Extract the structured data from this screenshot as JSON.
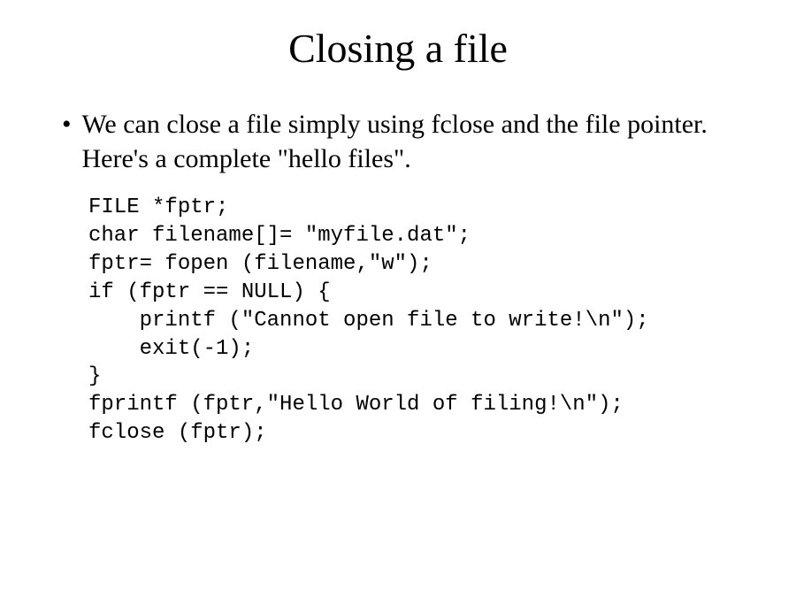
{
  "title": "Closing a file",
  "bullet": "•",
  "bullet_text": "We can close a file simply using fclose and the file pointer.  Here's a complete \"hello files\".",
  "code": "FILE *fptr;\nchar filename[]= \"myfile.dat\";\nfptr= fopen (filename,\"w\");\nif (fptr == NULL) {\n    printf (\"Cannot open file to write!\\n\");\n    exit(-1);\n}\nfprintf (fptr,\"Hello World of filing!\\n\");\nfclose (fptr);"
}
